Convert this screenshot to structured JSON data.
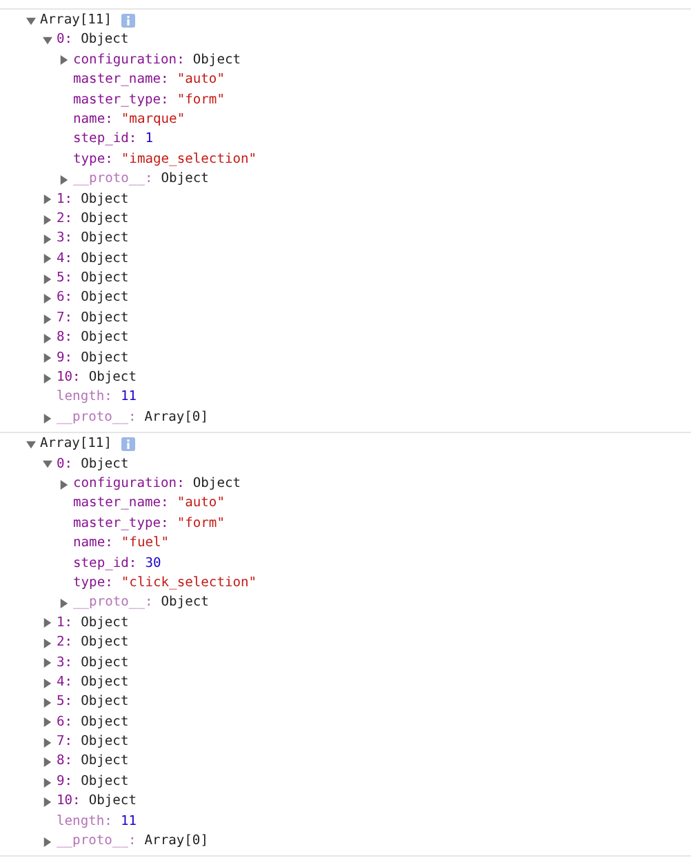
{
  "logs": [
    {
      "label": "Array[11]",
      "expanded": true,
      "children": [
        {
          "key": "0:",
          "value": "Object",
          "expanded": true,
          "dim": false,
          "children": [
            {
              "key": "configuration:",
              "value": "Object",
              "expanded": false,
              "dim": false
            },
            {
              "key": "master_name:",
              "value": "\"auto\"",
              "kind": "string",
              "dim": false
            },
            {
              "key": "master_type:",
              "value": "\"form\"",
              "kind": "string",
              "dim": false
            },
            {
              "key": "name:",
              "value": "\"marque\"",
              "kind": "string",
              "dim": false
            },
            {
              "key": "step_id:",
              "value": "1",
              "kind": "number",
              "dim": false
            },
            {
              "key": "type:",
              "value": "\"image_selection\"",
              "kind": "string",
              "dim": false
            },
            {
              "key": "__proto__:",
              "value": "Object",
              "expanded": false,
              "dim": true
            }
          ]
        },
        {
          "key": "1:",
          "value": "Object",
          "expanded": false,
          "dim": false
        },
        {
          "key": "2:",
          "value": "Object",
          "expanded": false,
          "dim": false
        },
        {
          "key": "3:",
          "value": "Object",
          "expanded": false,
          "dim": false
        },
        {
          "key": "4:",
          "value": "Object",
          "expanded": false,
          "dim": false
        },
        {
          "key": "5:",
          "value": "Object",
          "expanded": false,
          "dim": false
        },
        {
          "key": "6:",
          "value": "Object",
          "expanded": false,
          "dim": false
        },
        {
          "key": "7:",
          "value": "Object",
          "expanded": false,
          "dim": false
        },
        {
          "key": "8:",
          "value": "Object",
          "expanded": false,
          "dim": false
        },
        {
          "key": "9:",
          "value": "Object",
          "expanded": false,
          "dim": false
        },
        {
          "key": "10:",
          "value": "Object",
          "expanded": false,
          "dim": false
        },
        {
          "key": "length:",
          "value": "11",
          "kind": "number",
          "dim": true
        },
        {
          "key": "__proto__:",
          "value": "Array[0]",
          "expanded": false,
          "dim": true
        }
      ]
    },
    {
      "label": "Array[11]",
      "expanded": true,
      "children": [
        {
          "key": "0:",
          "value": "Object",
          "expanded": true,
          "dim": false,
          "children": [
            {
              "key": "configuration:",
              "value": "Object",
              "expanded": false,
              "dim": false
            },
            {
              "key": "master_name:",
              "value": "\"auto\"",
              "kind": "string",
              "dim": false
            },
            {
              "key": "master_type:",
              "value": "\"form\"",
              "kind": "string",
              "dim": false
            },
            {
              "key": "name:",
              "value": "\"fuel\"",
              "kind": "string",
              "dim": false
            },
            {
              "key": "step_id:",
              "value": "30",
              "kind": "number",
              "dim": false
            },
            {
              "key": "type:",
              "value": "\"click_selection\"",
              "kind": "string",
              "dim": false
            },
            {
              "key": "__proto__:",
              "value": "Object",
              "expanded": false,
              "dim": true
            }
          ]
        },
        {
          "key": "1:",
          "value": "Object",
          "expanded": false,
          "dim": false
        },
        {
          "key": "2:",
          "value": "Object",
          "expanded": false,
          "dim": false
        },
        {
          "key": "3:",
          "value": "Object",
          "expanded": false,
          "dim": false
        },
        {
          "key": "4:",
          "value": "Object",
          "expanded": false,
          "dim": false
        },
        {
          "key": "5:",
          "value": "Object",
          "expanded": false,
          "dim": false
        },
        {
          "key": "6:",
          "value": "Object",
          "expanded": false,
          "dim": false
        },
        {
          "key": "7:",
          "value": "Object",
          "expanded": false,
          "dim": false
        },
        {
          "key": "8:",
          "value": "Object",
          "expanded": false,
          "dim": false
        },
        {
          "key": "9:",
          "value": "Object",
          "expanded": false,
          "dim": false
        },
        {
          "key": "10:",
          "value": "Object",
          "expanded": false,
          "dim": false
        },
        {
          "key": "length:",
          "value": "11",
          "kind": "number",
          "dim": true
        },
        {
          "key": "__proto__:",
          "value": "Array[0]",
          "expanded": false,
          "dim": true
        }
      ]
    }
  ]
}
